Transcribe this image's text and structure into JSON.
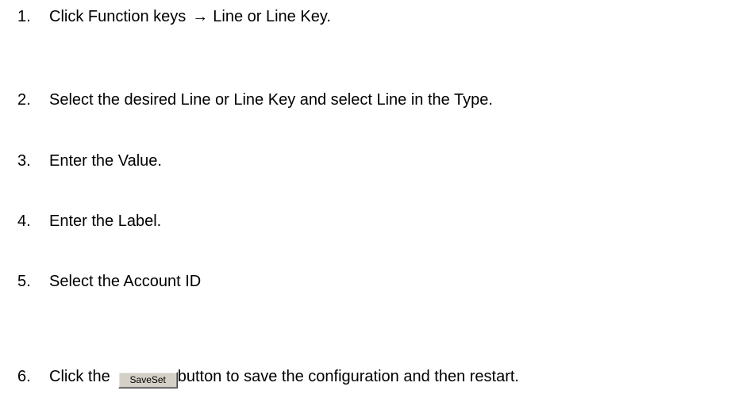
{
  "steps": [
    {
      "num": "1.",
      "text": "Click Function keys",
      "arrow": "→",
      "text_after": "Line or Line Key."
    },
    {
      "num": "2.",
      "text": "Select the desired Line or Line Key and select Line in the Type."
    },
    {
      "num": "3.",
      "text": "Enter the Value."
    },
    {
      "num": "4.",
      "text": "Enter the Label."
    },
    {
      "num": "5.",
      "text": "Select the Account ID"
    },
    {
      "num": "6.",
      "text": "Click the",
      "button_label": "SaveSet",
      "text_after": "button to save the configuration and then restart."
    }
  ]
}
